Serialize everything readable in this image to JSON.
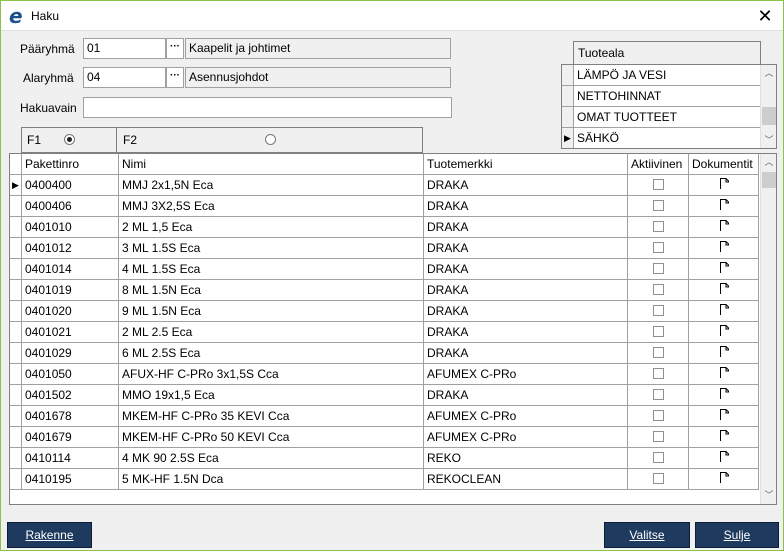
{
  "window": {
    "title": "Haku",
    "app_logo": "e",
    "close_glyph": "✕"
  },
  "form": {
    "paaryhma_label": "Pääryhmä",
    "paaryhma_code": "01",
    "paaryhma_name": "Kaapelit ja johtimet",
    "alaryhma_label": "Alaryhmä",
    "alaryhma_code": "04",
    "alaryhma_name": "Asennusjohdot",
    "hakuavain_label": "Hakuavain",
    "hakuavain_value": "",
    "browse_glyph": "···"
  },
  "fpanel": {
    "f1_label": "F1",
    "f2_label": "F2",
    "selected": "F1"
  },
  "tuoteala": {
    "header": "Tuoteala",
    "items": [
      {
        "label": "LÄMPÖ JA VESI",
        "current": false
      },
      {
        "label": "NETTOHINNAT",
        "current": false
      },
      {
        "label": "OMAT TUOTTEET",
        "current": false
      },
      {
        "label": "SÄHKÖ",
        "current": true
      }
    ]
  },
  "grid": {
    "columns": [
      "Pakettinro",
      "Nimi",
      "Tuotemerkki",
      "Aktiivinen",
      "Dokumentit"
    ],
    "rows": [
      {
        "nro": "0400400",
        "nimi": "MMJ 2x1,5N Eca",
        "merkki": "DRAKA",
        "aktiivinen": false,
        "current": true
      },
      {
        "nro": "0400406",
        "nimi": "MMJ 3X2,5S Eca",
        "merkki": "DRAKA",
        "aktiivinen": false,
        "current": false
      },
      {
        "nro": "0401010",
        "nimi": "2 ML 1,5 Eca",
        "merkki": "DRAKA",
        "aktiivinen": false,
        "current": false
      },
      {
        "nro": "0401012",
        "nimi": "3 ML 1.5S Eca",
        "merkki": "DRAKA",
        "aktiivinen": false,
        "current": false
      },
      {
        "nro": "0401014",
        "nimi": "4 ML 1.5S Eca",
        "merkki": "DRAKA",
        "aktiivinen": false,
        "current": false
      },
      {
        "nro": "0401019",
        "nimi": "8 ML 1.5N Eca",
        "merkki": "DRAKA",
        "aktiivinen": false,
        "current": false
      },
      {
        "nro": "0401020",
        "nimi": "9 ML 1.5N Eca",
        "merkki": "DRAKA",
        "aktiivinen": false,
        "current": false
      },
      {
        "nro": "0401021",
        "nimi": "2 ML 2.5 Eca",
        "merkki": "DRAKA",
        "aktiivinen": false,
        "current": false
      },
      {
        "nro": "0401029",
        "nimi": "6 ML 2.5S Eca",
        "merkki": "DRAKA",
        "aktiivinen": false,
        "current": false
      },
      {
        "nro": "0401050",
        "nimi": "AFUX-HF C-PRo 3x1,5S Cca",
        "merkki": "AFUMEX C-PRo",
        "aktiivinen": false,
        "current": false
      },
      {
        "nro": "0401502",
        "nimi": "MMO 19x1,5 Eca",
        "merkki": "DRAKA",
        "aktiivinen": false,
        "current": false
      },
      {
        "nro": "0401678",
        "nimi": "MKEM-HF C-PRo 35 KEVI Cca",
        "merkki": "AFUMEX C-PRo",
        "aktiivinen": false,
        "current": false
      },
      {
        "nro": "0401679",
        "nimi": "MKEM-HF C-PRo 50 KEVI Cca",
        "merkki": "AFUMEX C-PRo",
        "aktiivinen": false,
        "current": false
      },
      {
        "nro": "0410114",
        "nimi": "4 MK 90 2.5S Eca",
        "merkki": "REKO",
        "aktiivinen": false,
        "current": false
      },
      {
        "nro": "0410195",
        "nimi": "5 MK-HF 1.5N Dca",
        "merkki": "REKOCLEAN",
        "aktiivinen": false,
        "current": false
      }
    ]
  },
  "buttons": {
    "rakenne": "Rakenne",
    "valitse": "Valitse",
    "sulje": "Sulje"
  },
  "colors": {
    "button_bg": "#1f3a5f",
    "window_border": "#8bc34a",
    "logo": "#1a4f8b"
  },
  "icons": {
    "current_row": "play-triangle",
    "document": "document-icon",
    "scroll_up": "chevron-up-icon",
    "scroll_down": "chevron-down-icon"
  }
}
